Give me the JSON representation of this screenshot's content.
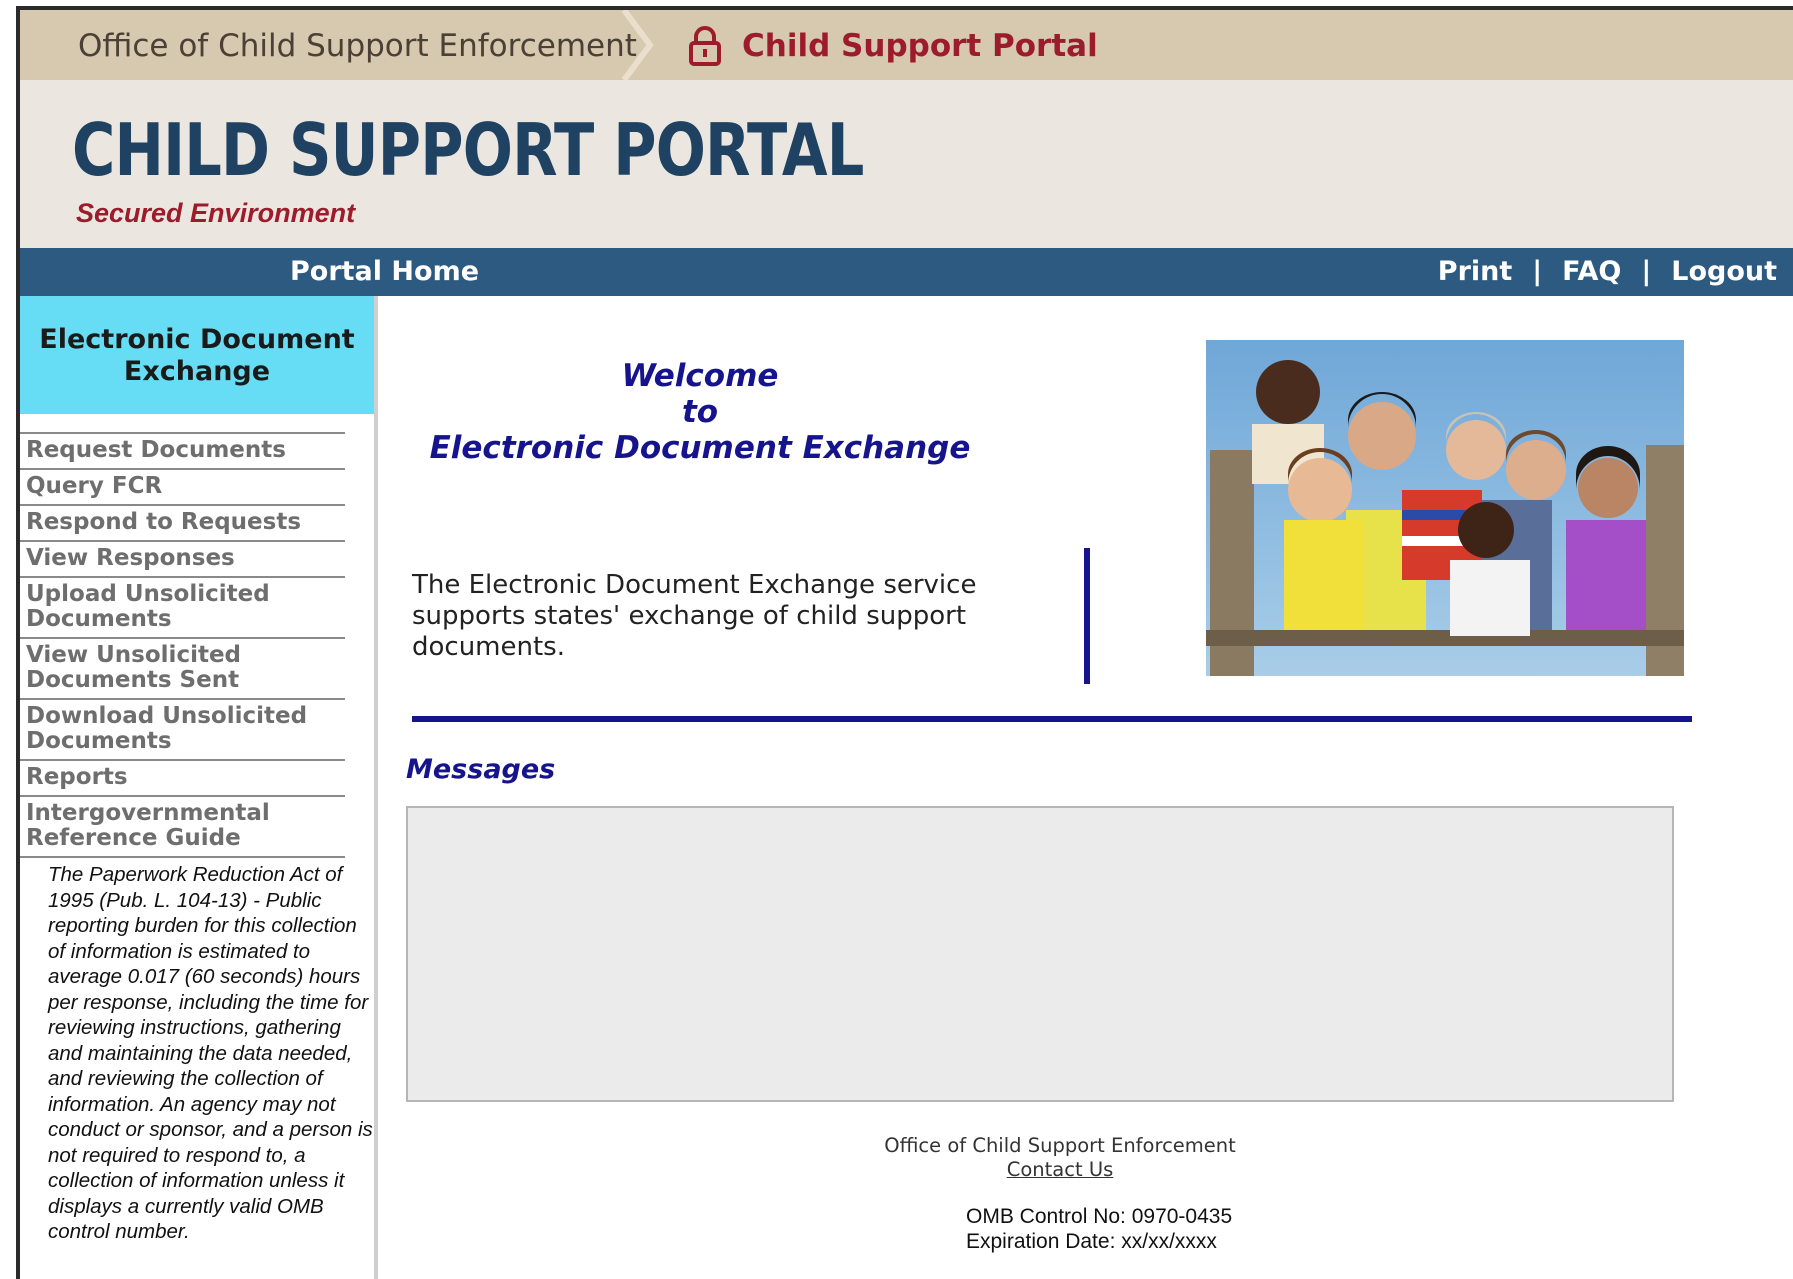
{
  "topbar": {
    "org_label": "Office of Child Support Enforcement",
    "portal_label": "Child Support Portal"
  },
  "header": {
    "title": "CHILD SUPPORT PORTAL",
    "subtitle": "Secured Environment"
  },
  "navbar": {
    "home": "Portal Home",
    "print": "Print",
    "faq": "FAQ",
    "logout": "Logout",
    "separator": "|"
  },
  "sidebar": {
    "section_title_line1": "Electronic Document",
    "section_title_line2": "Exchange",
    "items": [
      {
        "label": "Request Documents"
      },
      {
        "label": "Query FCR"
      },
      {
        "label": "Respond to Requests"
      },
      {
        "label": "View Responses"
      },
      {
        "label": "Upload Unsolicited Documents"
      },
      {
        "label": "View Unsolicited Documents Sent"
      },
      {
        "label": "Download Unsolicited Documents"
      },
      {
        "label": "Reports"
      },
      {
        "label": "Intergovernmental Reference Guide"
      }
    ],
    "pra_notice": "The Paperwork Reduction Act of 1995 (Pub. L. 104-13) - Public reporting burden for this collection of information is estimated to average 0.017 (60 seconds) hours per response, including the time for reviewing instructions, gathering and maintaining the data needed, and reviewing the collection of information.  An agency may not conduct or sponsor, and a person is not required to respond to, a collection of information unless it displays a currently valid OMB control number."
  },
  "main": {
    "welcome_line1": "Welcome",
    "welcome_line2": "to",
    "welcome_line3": "Electronic Document Exchange",
    "intro": "The Electronic Document Exchange service supports states' exchange of child support documents.",
    "messages_title": "Messages"
  },
  "footer": {
    "org": "Office of Child Support Enforcement",
    "contact": "Contact Us",
    "omb_control": "OMB Control No: 0970-0435",
    "expiration": "Expiration Date: xx/xx/xxxx"
  },
  "colors": {
    "topbar_bg": "#d6c9b0",
    "brand_red": "#9c1c2b",
    "title_blue": "#1f4263",
    "nav_bg": "#2d5a80",
    "section_cyan": "#66ddf4",
    "accent_navy": "#16148c"
  }
}
